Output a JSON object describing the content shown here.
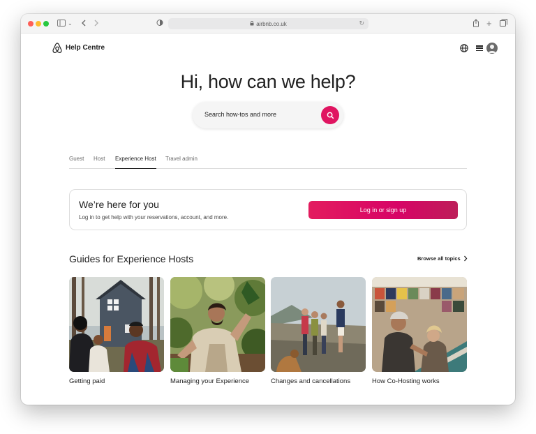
{
  "browser": {
    "url": "airbnb.co.uk",
    "icons": [
      "sidebar-icon",
      "back-icon",
      "forward-icon",
      "shield-icon",
      "lock-icon",
      "reload-icon",
      "share-icon",
      "new-tab-icon",
      "tabs-overview-icon"
    ]
  },
  "header": {
    "brand": "Help Centre",
    "icons": [
      "airbnb-logo-icon",
      "globe-icon",
      "menu-icon",
      "user-avatar-icon"
    ]
  },
  "hero": {
    "title": "Hi, how can we help?",
    "search_placeholder": "Search how-tos and more"
  },
  "tabs": [
    {
      "label": "Guest"
    },
    {
      "label": "Host"
    },
    {
      "label": "Experience Host",
      "active": true
    },
    {
      "label": "Travel admin"
    }
  ],
  "card": {
    "title": "We’re here for you",
    "subtitle": "Log in to get help with your reservations, account, and more.",
    "button": "Log in or sign up"
  },
  "guides": {
    "title": "Guides for Experience Hosts",
    "browse": "Browse all topics",
    "items": [
      {
        "caption": "Getting paid"
      },
      {
        "caption": "Managing your Experience"
      },
      {
        "caption": "Changes and cancellations"
      },
      {
        "caption": "How Co-Hosting works"
      }
    ]
  },
  "colors": {
    "brand": "#e01561",
    "text": "#222222",
    "muted": "#6a6a6a",
    "border": "#dddddd"
  }
}
